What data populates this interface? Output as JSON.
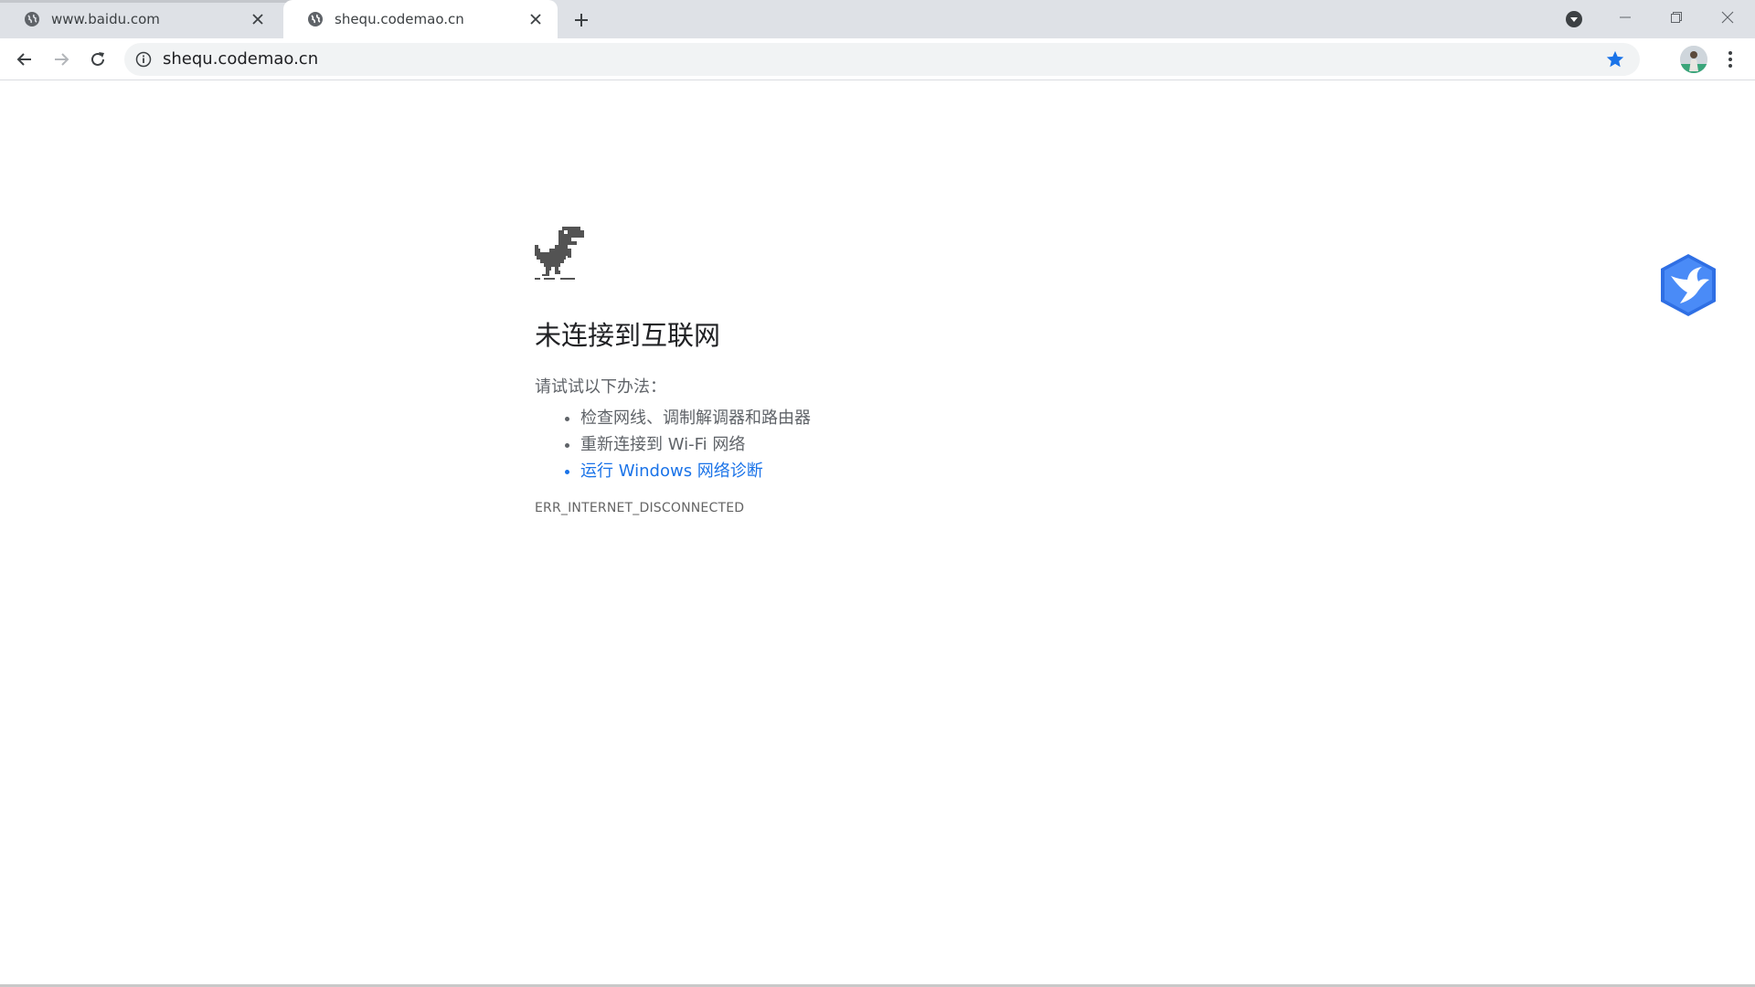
{
  "tabs": [
    {
      "title": "www.baidu.com",
      "active": false
    },
    {
      "title": "shequ.codemao.cn",
      "active": true
    }
  ],
  "tabstrip": {
    "new_tab_icon": "plus-icon",
    "tab_search_icon": "chevron-down-circle-icon"
  },
  "window_controls": {
    "minimize_icon": "minimize-icon",
    "restore_icon": "restore-icon",
    "close_icon": "close-icon"
  },
  "toolbar": {
    "back_icon": "arrow-left-icon",
    "forward_icon": "arrow-right-icon",
    "reload_icon": "reload-icon",
    "url": "shequ.codemao.cn",
    "site_info_icon": "info-icon",
    "bookmark_icon": "star-icon",
    "bookmarked": true,
    "menu_icon": "kebab-menu-icon"
  },
  "error_page": {
    "title": "未连接到互联网",
    "try_text": "请试试以下办法：",
    "suggestions": [
      "检查网线、调制解调器和路由器",
      "重新连接到 Wi-Fi 网络",
      "运行 Windows 网络诊断"
    ],
    "error_code": "ERR_INTERNET_DISCONNECTED"
  },
  "colors": {
    "tabstrip_bg": "#dee1e6",
    "omnibox_bg": "#f1f3f4",
    "accent_blue": "#1a73e8",
    "title_text": "#202124",
    "body_text": "#5f6368",
    "widget_blue": "#3d7ff5"
  }
}
